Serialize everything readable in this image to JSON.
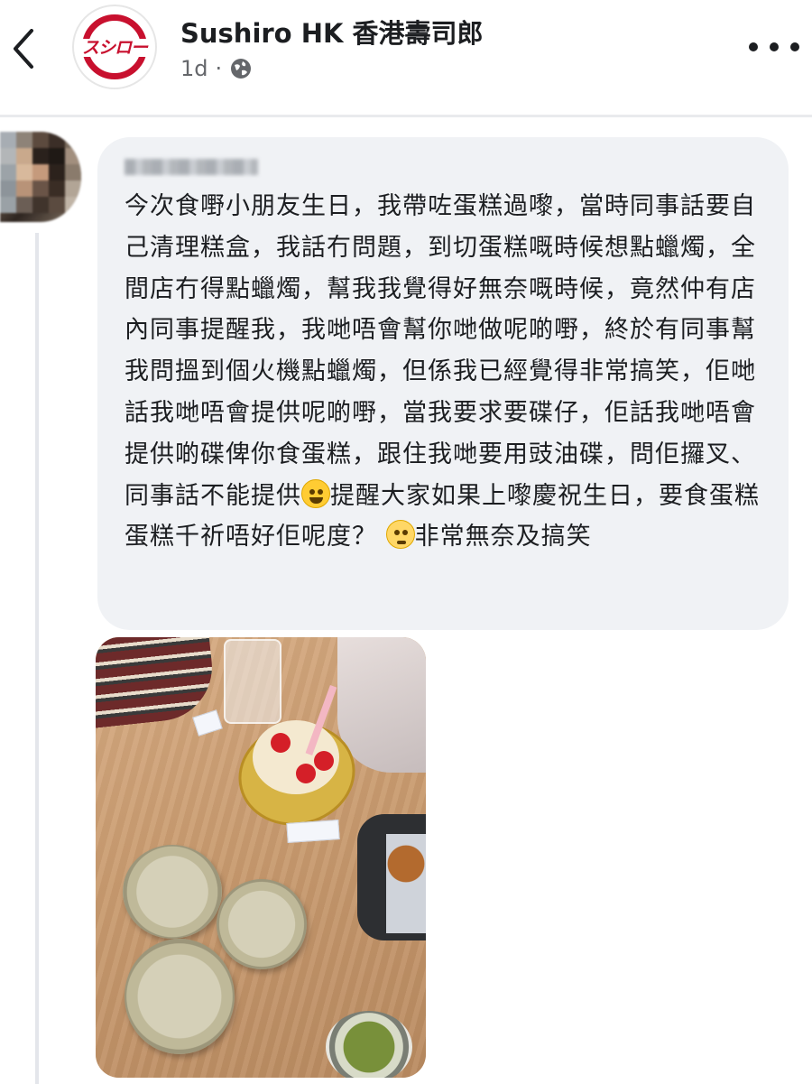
{
  "header": {
    "back_icon": "chevron-left-icon",
    "page_name": "Sushiro HK 香港壽司郎",
    "logo_text": "スシロー",
    "time": "1d",
    "separator": "·",
    "privacy_icon": "globe-icon",
    "more_icon": "more-horizontal-icon"
  },
  "comment": {
    "author_name_blurred": true,
    "text_part1": "今次食嘢小朋友生日，我帶咗蛋糕過嚟，當時同事話要自己清理糕盒，我話冇問題，到切蛋糕嘅時候想點蠟燭，全間店冇得點蠟燭，幫我我覺得好無奈嘅時候，竟然仲有店內同事提醒我，我哋唔會幫你哋做呢啲嘢，終於有同事幫我問搵到個火機點蠟燭，但係我已經覺得非常搞笑，佢哋話我哋唔會提供呢啲嘢，當我要求要碟仔，佢話我哋唔會提供啲碟俾你食蛋糕，跟住我哋要用豉油碟，問佢攞叉、同事話不能提供",
    "emoji1": "rolling-on-floor-laughing-emoji",
    "text_part2": "提醒大家如果上嚟慶祝生日，要食蛋糕蛋糕千祈唔好佢呢度？ ",
    "emoji2": "pleading-face-emoji",
    "text_part3": "非常無奈及搞笑"
  },
  "attachment": {
    "type": "photo",
    "subject": "birthday-cake-and-plates-on-table"
  },
  "colors": {
    "bubble_bg": "#f0f2f5",
    "text": "#1c1e21",
    "meta": "#65676b",
    "brand_red": "#c8102e"
  }
}
